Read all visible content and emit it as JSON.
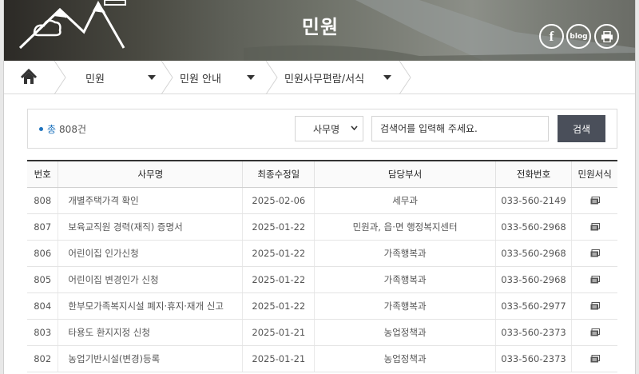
{
  "header": {
    "title": "민원"
  },
  "sns": {
    "facebook_label": "f",
    "blog_label": "blog"
  },
  "breadcrumb": {
    "items": [
      "민원",
      "민원 안내",
      "민원사무편람/서식"
    ]
  },
  "search": {
    "total_label": "총",
    "total_count": "808건",
    "field_selected": "사무명",
    "placeholder": "검색어를 입력해 주세요.",
    "button_label": "검색"
  },
  "table": {
    "headers": [
      "번호",
      "사무명",
      "최종수정일",
      "담당부서",
      "전화번호",
      "민원서식"
    ],
    "rows": [
      {
        "no": "808",
        "subject": "개별주택가격 확인",
        "date": "2025-02-06",
        "dept": "세무과",
        "tel": "033-560-2149"
      },
      {
        "no": "807",
        "subject": "보육교직원 경력(재직) 증명서",
        "date": "2025-01-22",
        "dept": "민원과, 읍·면 행정복지센터",
        "tel": "033-560-2968"
      },
      {
        "no": "806",
        "subject": "어린이집 인가신청",
        "date": "2025-01-22",
        "dept": "가족행복과",
        "tel": "033-560-2968"
      },
      {
        "no": "805",
        "subject": "어린이집 변경인가 신청",
        "date": "2025-01-22",
        "dept": "가족행복과",
        "tel": "033-560-2968"
      },
      {
        "no": "804",
        "subject": "한부모가족복지시설 폐지·휴지·재개 신고",
        "date": "2025-01-22",
        "dept": "가족행복과",
        "tel": "033-560-2977"
      },
      {
        "no": "803",
        "subject": "타용도 환지지정 신청",
        "date": "2025-01-21",
        "dept": "농업정책과",
        "tel": "033-560-2373"
      },
      {
        "no": "802",
        "subject": "농업기반시설(변경)등록",
        "date": "2025-01-21",
        "dept": "농업정책과",
        "tel": "033-560-2373"
      }
    ]
  },
  "colors": {
    "accent": "#1e73be",
    "button": "#4a4f5a"
  }
}
